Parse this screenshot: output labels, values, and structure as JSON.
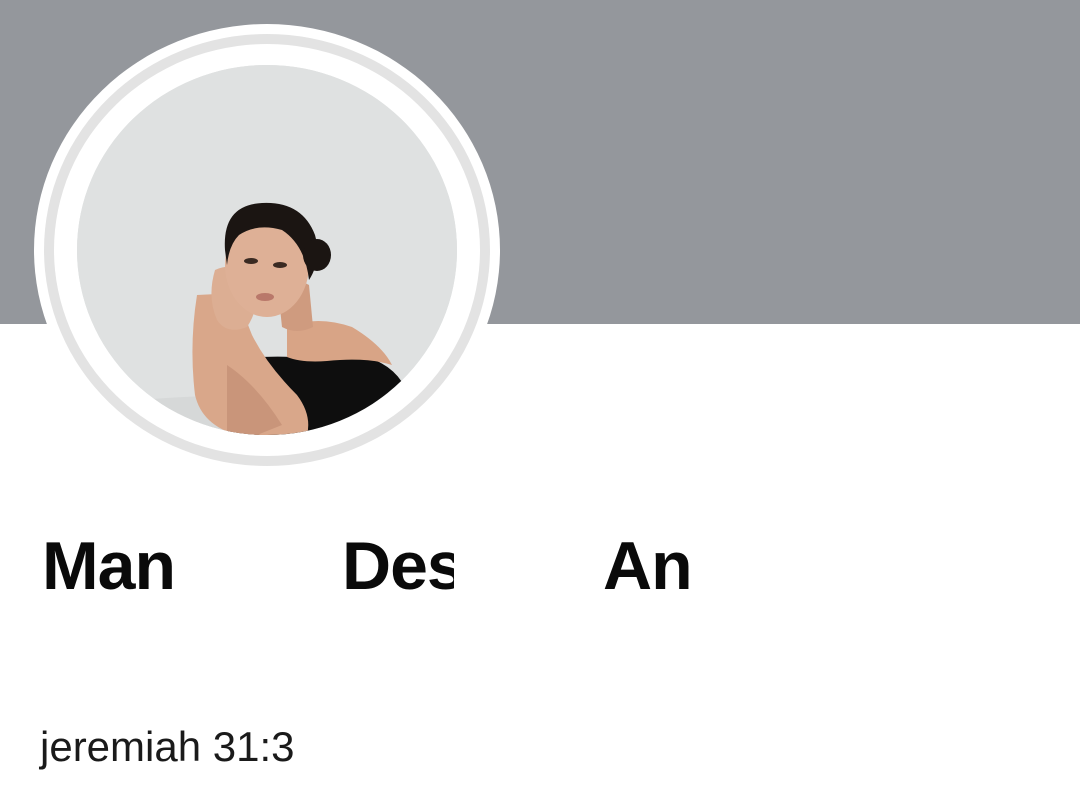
{
  "profile": {
    "name_parts": [
      "Man",
      "Des",
      "An"
    ],
    "bio": "jeremiah 31:3"
  },
  "avatar": {
    "icon": "profile-photo",
    "description_colors": {
      "background": "#dfe1e1",
      "dress": "#0e0e0e",
      "skin": "#d9a78a",
      "hair": "#1b1512"
    }
  },
  "cover": {
    "color": "#94979c"
  }
}
